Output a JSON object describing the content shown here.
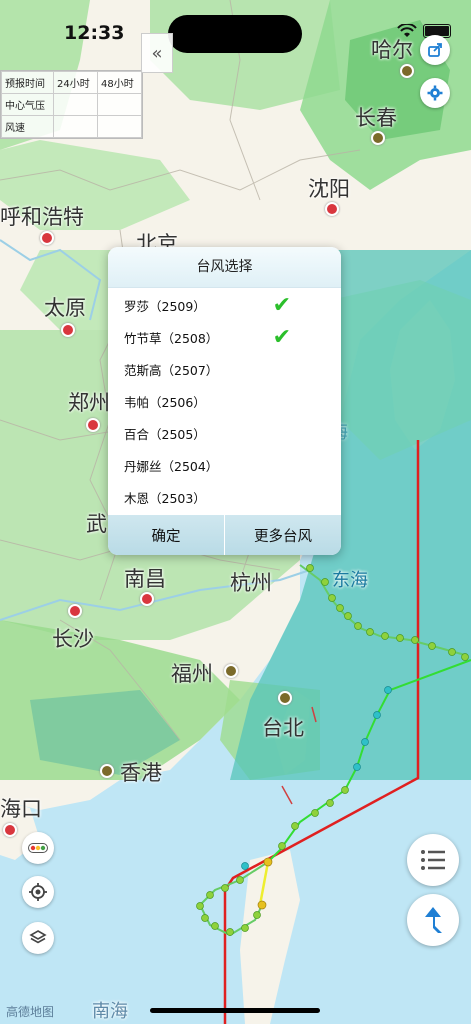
{
  "status_bar": {
    "time": "12:33"
  },
  "info_table": {
    "header": [
      "预报时间",
      "24小时",
      "48小时"
    ],
    "rows": [
      [
        "中心气压",
        "",
        ""
      ],
      [
        "风速",
        "",
        ""
      ]
    ]
  },
  "map": {
    "labels": {
      "haerbin": "哈尔",
      "changchun": "长春",
      "shenyang": "沈阳",
      "huhehaote": "呼和浩特",
      "beijing": "北京",
      "taiyuan": "太原",
      "zhengzhou": "郑州",
      "wu": "武",
      "nanchang": "南昌",
      "hangzhou": "杭州",
      "donghai": "东海",
      "changsha": "长沙",
      "fuzhou": "福州",
      "taibei": "台北",
      "xianggang": "香港",
      "haikou": "海口",
      "nanhai": "南海",
      "hai": "海"
    },
    "brand": "高德地图"
  },
  "dialog": {
    "title": "台风选择",
    "typhoons": [
      {
        "name": "罗莎（2509）",
        "checked": true
      },
      {
        "name": "竹节草（2508）",
        "checked": true
      },
      {
        "name": "范斯高（2507）",
        "checked": false
      },
      {
        "name": "韦帕（2506）",
        "checked": false
      },
      {
        "name": "百合（2505）",
        "checked": false
      },
      {
        "name": "丹娜丝（2504）",
        "checked": false
      },
      {
        "name": "木恩（2503）",
        "checked": false
      }
    ],
    "confirm_label": "确定",
    "more_label": "更多台风"
  },
  "colors": {
    "land": "#f6f3ea",
    "forecast_green": "#8fd98f",
    "sea_teal": "#55c4b8",
    "track_red": "#e02020",
    "track_green": "#33dd33",
    "accent_blue": "#1f7fd4"
  },
  "icons": [
    "share-icon",
    "gear-icon",
    "traffic-icon",
    "locate-icon",
    "layers-icon",
    "list-icon",
    "navigate-icon",
    "collapse-icon",
    "check-icon"
  ]
}
